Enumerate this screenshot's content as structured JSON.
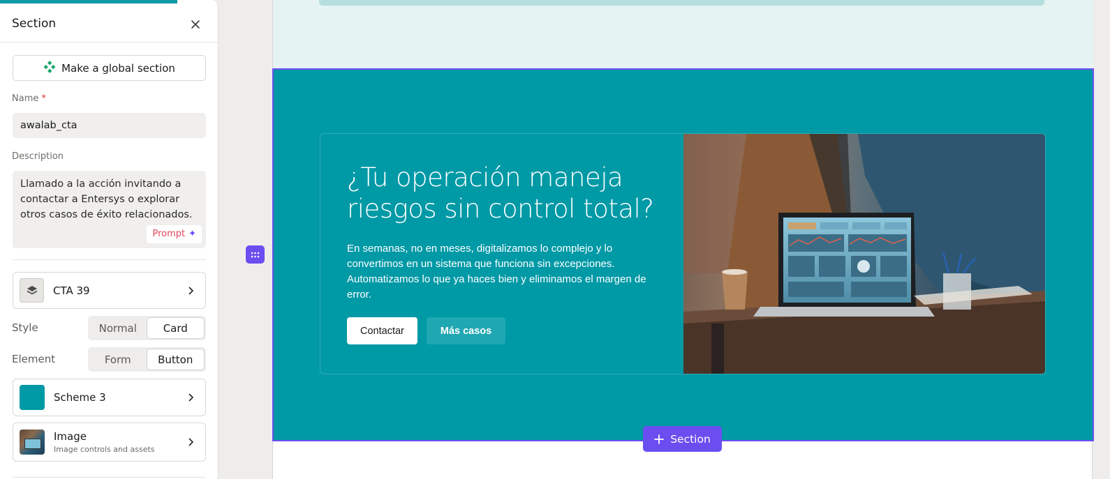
{
  "panel": {
    "title": "Section",
    "global_button_label": "Make a global section",
    "name_label": "Name",
    "name_required_mark": "*",
    "name_value": "awalab_cta",
    "description_label": "Description",
    "description_value": "Llamado a la acción invitando a contactar a Entersys o explorar otros casos de éxito relacionados.",
    "prompt_label": "Prompt",
    "template_name": "CTA 39",
    "style": {
      "label": "Style",
      "options": [
        "Normal",
        "Card"
      ],
      "selected": "Card"
    },
    "element": {
      "label": "Element",
      "options": [
        "Form",
        "Button"
      ],
      "selected": "Button"
    },
    "scheme": {
      "label": "Scheme 3",
      "color": "#0099a6"
    },
    "image": {
      "label": "Image",
      "sub": "Image controls and assets"
    }
  },
  "canvas": {
    "section_color": "#0099a6",
    "card": {
      "title_line1": "¿Tu operación maneja",
      "title_line2": "riesgos sin control total?",
      "body": "En semanas, no en meses, digitalizamos lo complejo y lo convertimos en un sistema que funciona sin excepciones. Automatizamos lo que ya haces bien y eliminamos el margen de error.",
      "primary_button": "Contactar",
      "secondary_button": "Más casos"
    },
    "add_section_label": "Section"
  },
  "colors": {
    "accent": "#6b4ef0",
    "brand": "#0f9aa6",
    "required": "#d9383a",
    "prompt": "#e0455c"
  }
}
